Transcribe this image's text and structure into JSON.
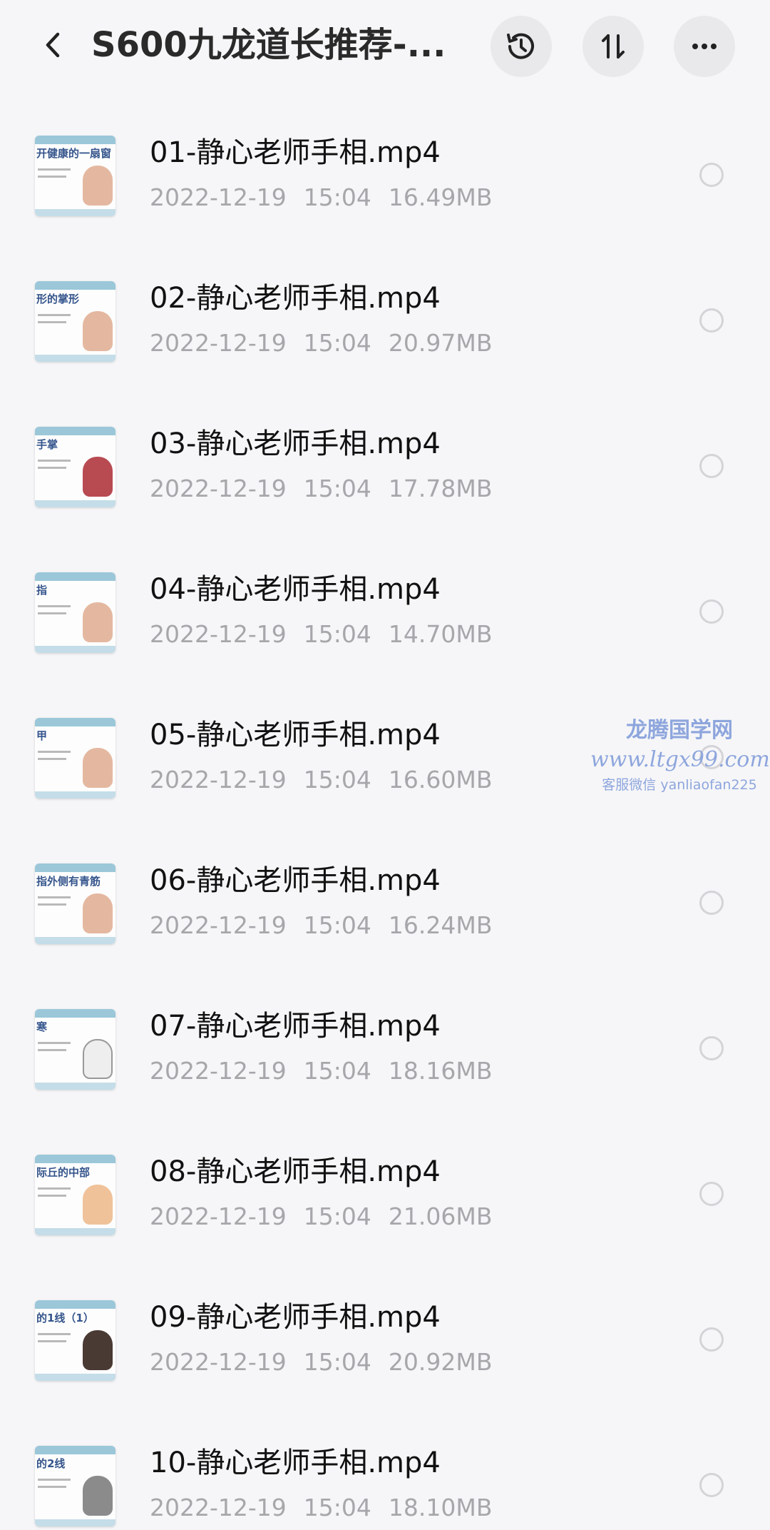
{
  "header": {
    "title": "S600九龙道长推荐-..."
  },
  "files": [
    {
      "name": "01-静心老师手相.mp4",
      "date": "2022-12-19",
      "time": "15:04",
      "size": "16.49MB",
      "thumb_text": "开健康的一扇窗"
    },
    {
      "name": "02-静心老师手相.mp4",
      "date": "2022-12-19",
      "time": "15:04",
      "size": "20.97MB",
      "thumb_text": "形的掌形"
    },
    {
      "name": "03-静心老师手相.mp4",
      "date": "2022-12-19",
      "time": "15:04",
      "size": "17.78MB",
      "thumb_text": "手掌"
    },
    {
      "name": "04-静心老师手相.mp4",
      "date": "2022-12-19",
      "time": "15:04",
      "size": "14.70MB",
      "thumb_text": "指"
    },
    {
      "name": "05-静心老师手相.mp4",
      "date": "2022-12-19",
      "time": "15:04",
      "size": "16.60MB",
      "thumb_text": "甲"
    },
    {
      "name": "06-静心老师手相.mp4",
      "date": "2022-12-19",
      "time": "15:04",
      "size": "16.24MB",
      "thumb_text": "指外侧有青筋"
    },
    {
      "name": "07-静心老师手相.mp4",
      "date": "2022-12-19",
      "time": "15:04",
      "size": "18.16MB",
      "thumb_text": "寒"
    },
    {
      "name": "08-静心老师手相.mp4",
      "date": "2022-12-19",
      "time": "15:04",
      "size": "21.06MB",
      "thumb_text": "际丘的中部"
    },
    {
      "name": "09-静心老师手相.mp4",
      "date": "2022-12-19",
      "time": "15:04",
      "size": "20.92MB",
      "thumb_text": "的1线（1）"
    },
    {
      "name": "10-静心老师手相.mp4",
      "date": "2022-12-19",
      "time": "15:04",
      "size": "18.10MB",
      "thumb_text": "的2线"
    }
  ],
  "watermark": {
    "line1": "龙腾国学网",
    "line2": "www.ltgx99.com",
    "line3": "客服微信 yanliaofan225"
  },
  "colors": {
    "background": "#f6f6f8",
    "title": "#2a2a2a",
    "filename": "#111111",
    "meta": "#a7a7ab",
    "watermark": "#8ea6dd"
  }
}
